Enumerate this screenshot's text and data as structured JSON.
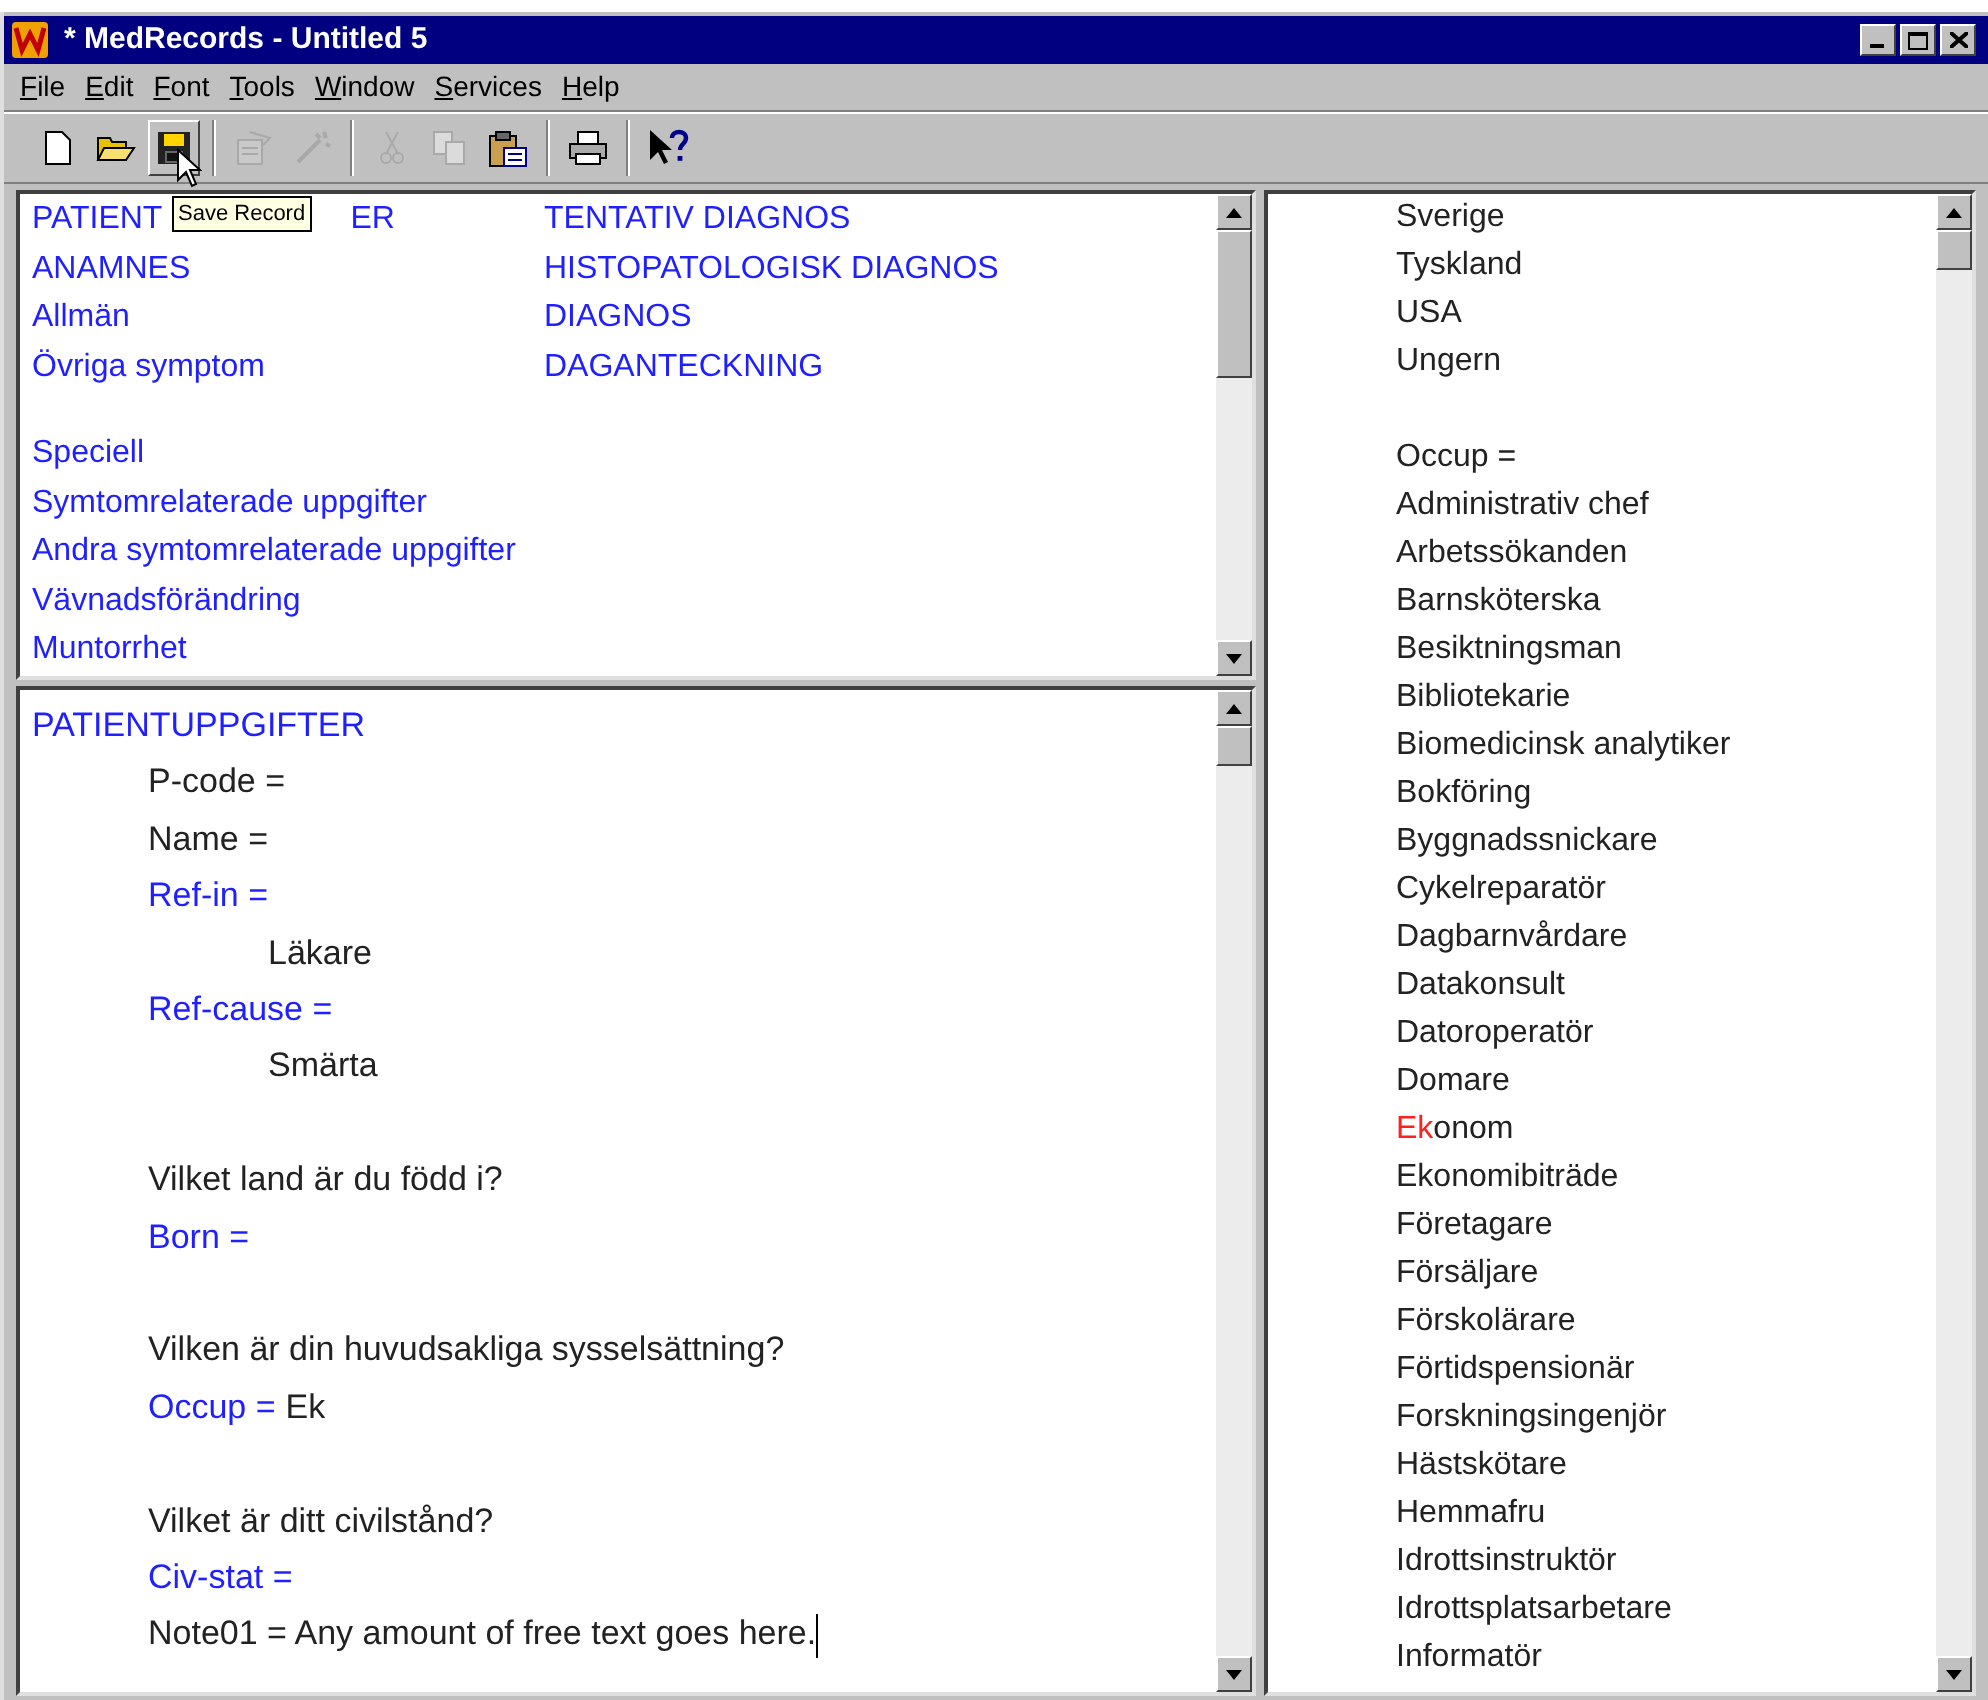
{
  "window": {
    "title": "* MedRecords - Untitled 5"
  },
  "menu": [
    "File",
    "Edit",
    "Font",
    "Tools",
    "Window",
    "Services",
    "Help"
  ],
  "toolbar": [
    {
      "kind": "new",
      "disabled": false,
      "pressed": false
    },
    {
      "kind": "open",
      "disabled": false,
      "pressed": false
    },
    {
      "kind": "save",
      "disabled": false,
      "pressed": true
    },
    {
      "kind": "separator"
    },
    {
      "kind": "properties",
      "disabled": true,
      "pressed": false
    },
    {
      "kind": "wand",
      "disabled": true,
      "pressed": false
    },
    {
      "kind": "separator"
    },
    {
      "kind": "cut",
      "disabled": true,
      "pressed": false
    },
    {
      "kind": "copy",
      "disabled": true,
      "pressed": false
    },
    {
      "kind": "paste",
      "disabled": false,
      "pressed": false
    },
    {
      "kind": "separator"
    },
    {
      "kind": "print",
      "disabled": false,
      "pressed": false
    },
    {
      "kind": "separator"
    },
    {
      "kind": "help",
      "disabled": false,
      "pressed": false
    }
  ],
  "tooltip": "Save Record",
  "index": {
    "left": [
      {
        "text": "PATIENT",
        "tail": "ER"
      },
      {
        "text": "ANAMNES"
      },
      {
        "text": "Allmän"
      },
      {
        "text": "Övriga symptom"
      },
      {
        "kind": "blank"
      },
      {
        "text": "Speciell"
      },
      {
        "text": "Symtomrelaterade uppgifter"
      },
      {
        "text": "Andra symtomrelaterade uppgifter"
      },
      {
        "text": "Vävnadsförändring"
      },
      {
        "text": "Muntorrhet"
      }
    ],
    "right": [
      {
        "text": "TENTATIV DIAGNOS"
      },
      {
        "text": "HISTOPATOLOGISK DIAGNOS"
      },
      {
        "text": "DIAGNOS"
      },
      {
        "text": "DAGANTECKNING"
      }
    ]
  },
  "editor": [
    {
      "kind": "heading",
      "text": "PATIENTUPPGIFTER"
    },
    {
      "kind": "text",
      "text": "P-code ="
    },
    {
      "kind": "text",
      "text": "Name ="
    },
    {
      "kind": "field",
      "text": "Ref-in ="
    },
    {
      "kind": "answer",
      "text": "Läkare"
    },
    {
      "kind": "field",
      "text": "Ref-cause ="
    },
    {
      "kind": "answer",
      "text": "Smärta"
    },
    {
      "kind": "blank"
    },
    {
      "kind": "text",
      "text": "Vilket land är du född i?"
    },
    {
      "kind": "field",
      "text": "Born ="
    },
    {
      "kind": "blank"
    },
    {
      "kind": "text",
      "text": "Vilken är din huvudsakliga sysselsättning?"
    },
    {
      "kind": "field",
      "text": "Occup =",
      "value": "Ek"
    },
    {
      "kind": "blank"
    },
    {
      "kind": "text",
      "text": "Vilket är ditt civilstånd?"
    },
    {
      "kind": "field",
      "text": "Civ-stat ="
    },
    {
      "kind": "text",
      "text": "Note01 = Any amount of free text goes here.",
      "caret": true
    }
  ],
  "choices": [
    {
      "kind": "item",
      "text": "Sverige"
    },
    {
      "kind": "item",
      "text": "Tyskland"
    },
    {
      "kind": "item",
      "text": "USA"
    },
    {
      "kind": "item",
      "text": "Ungern"
    },
    {
      "kind": "blank"
    },
    {
      "kind": "item",
      "text": "Occup ="
    },
    {
      "kind": "item",
      "text": "Administrativ chef"
    },
    {
      "kind": "item",
      "text": "Arbetssökanden"
    },
    {
      "kind": "item",
      "text": "Barnsköterska"
    },
    {
      "kind": "item",
      "text": "Besiktningsman"
    },
    {
      "kind": "item",
      "text": "Bibliotekarie"
    },
    {
      "kind": "item",
      "text": "Biomedicinsk analytiker"
    },
    {
      "kind": "item",
      "text": "Bokföring"
    },
    {
      "kind": "item",
      "text": "Byggnadssnickare"
    },
    {
      "kind": "item",
      "text": "Cykelreparatör"
    },
    {
      "kind": "item",
      "text": "Dagbarnvårdare"
    },
    {
      "kind": "item",
      "text": "Datakonsult"
    },
    {
      "kind": "item",
      "text": "Datoroperatör"
    },
    {
      "kind": "item",
      "text": "Domare"
    },
    {
      "kind": "match",
      "match": "Ek",
      "text": "onom"
    },
    {
      "kind": "item",
      "text": "Ekonomibiträde"
    },
    {
      "kind": "item",
      "text": "Företagare"
    },
    {
      "kind": "item",
      "text": "Försäljare"
    },
    {
      "kind": "item",
      "text": "Förskolärare"
    },
    {
      "kind": "item",
      "text": "Förtidspensionär"
    },
    {
      "kind": "item",
      "text": "Forskningsingenjör"
    },
    {
      "kind": "item",
      "text": "Hästskötare"
    },
    {
      "kind": "item",
      "text": "Hemmafru"
    },
    {
      "kind": "item",
      "text": "Idrottsinstruktör"
    },
    {
      "kind": "item",
      "text": "Idrottsplatsarbetare"
    },
    {
      "kind": "item",
      "text": "Informatör"
    }
  ]
}
